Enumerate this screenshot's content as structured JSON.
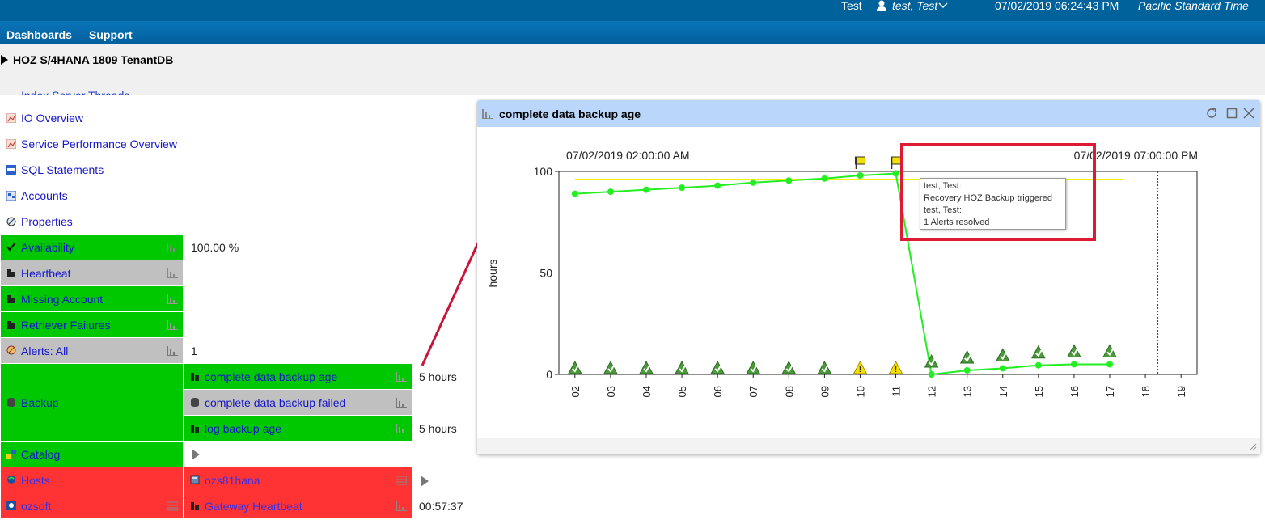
{
  "topbar": {
    "user_label": "Test",
    "user_name": "test, Test",
    "datetime": "07/02/2019 06:24:43 PM",
    "timezone": "Pacific Standard Time"
  },
  "nav": {
    "dashboards": "Dashboards",
    "support": "Support"
  },
  "header": {
    "title": "HOZ S/4HANA 1809 TenantDB"
  },
  "left": {
    "cut_item": "Index Server Threads",
    "links": [
      {
        "label": "IO Overview",
        "icon": "chart-icon"
      },
      {
        "label": "Service Performance Overview",
        "icon": "chart-icon"
      },
      {
        "label": "SQL Statements",
        "icon": "sql-icon"
      },
      {
        "label": "Accounts",
        "icon": "accounts-icon"
      },
      {
        "label": "Properties",
        "icon": "properties-icon"
      }
    ],
    "availability": {
      "label": "Availability",
      "value": "100.00 %"
    },
    "heartbeat": {
      "label": "Heartbeat"
    },
    "missing_account": {
      "label": "Missing Account"
    },
    "retriever_failures": {
      "label": "Retriever Failures"
    },
    "alerts": {
      "label": "Alerts: All",
      "value": "1"
    },
    "backup": {
      "label": "Backup",
      "items": [
        {
          "label": "complete data backup age",
          "value": "5 hours"
        },
        {
          "label": "complete data backup failed",
          "value": ""
        },
        {
          "label": "log backup age",
          "value": "5 hours"
        }
      ]
    },
    "catalog": {
      "label": "Catalog"
    },
    "hosts": {
      "label": "Hosts",
      "child": "ozs81hana"
    },
    "ozsoft": {
      "label": "ozsoft",
      "child": "Gateway Heartbeat",
      "value": "00:57:37"
    }
  },
  "panel": {
    "title": "complete data backup age",
    "start_time": "07/02/2019 02:00:00 AM",
    "end_time": "07/02/2019 07:00:00 PM"
  },
  "tooltip": {
    "lines": [
      "test, Test:",
      "Recovery HOZ Backup triggered",
      "test, Test:",
      "1 Alerts resolved"
    ]
  },
  "chart_data": {
    "type": "line",
    "title": "",
    "ylabel": "hours",
    "xlabel": "",
    "ylim": [
      0,
      100
    ],
    "yticks": [
      0,
      50,
      100
    ],
    "x_ticks": [
      "02",
      "03",
      "04",
      "05",
      "06",
      "07",
      "08",
      "09",
      "10",
      "11",
      "12",
      "13",
      "14",
      "15",
      "16",
      "17",
      "18",
      "19"
    ],
    "series": [
      {
        "color": "#22ee22",
        "x": [
          2,
          3,
          4,
          5,
          6,
          7,
          8,
          9,
          10,
          11,
          12,
          13,
          14,
          15,
          16,
          17
        ],
        "values": [
          89,
          90,
          91,
          92,
          93,
          94.5,
          95.5,
          96.5,
          98,
          99,
          0,
          2,
          3,
          4.5,
          5,
          5
        ]
      }
    ],
    "threshold": {
      "value": 96,
      "color": "#f2f200"
    },
    "status_icons": [
      "ok",
      "ok",
      "ok",
      "ok",
      "ok",
      "ok",
      "ok",
      "ok",
      "warning",
      "warning",
      "ok",
      "ok",
      "ok",
      "ok",
      "ok",
      "ok"
    ],
    "annotation_flags_x": [
      10,
      11
    ],
    "grid_y": [
      50
    ],
    "colors": {
      "line": "#22ee22",
      "threshold": "#f2f200"
    }
  }
}
